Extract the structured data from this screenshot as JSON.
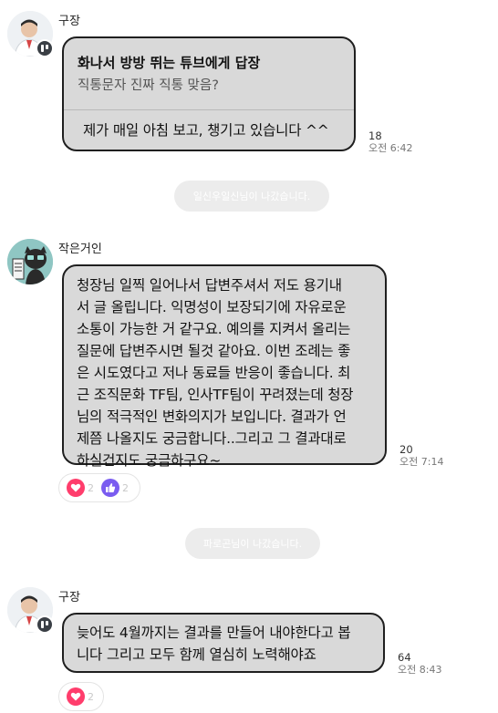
{
  "messages": [
    {
      "sender": "구장",
      "reply_title": "화나서 방방 뛰는 튜브에게 답장",
      "reply_quote": "직통문자 진짜 직통 맞음?",
      "text": "제가 매일 아침 보고, 챙기고 있습니다 ^^",
      "read_count": "18",
      "time": "오전 6:42"
    },
    {
      "system": "일신우일신님이 나갔습니다."
    },
    {
      "sender": "작은거인",
      "lines": [
        "청장님 일찍 일어나서 답변주셔서 저도 용기내",
        "서 글 올립니다. 익명성이 보장되기에 자유로운",
        "소통이 가능한 거 같구요. 예의를 지켜서 올리는",
        "질문에 답변주시면 될것 같아요. 이번 조례는 좋",
        "은 시도였다고 저나 동료들 반응이 좋습니다. 최",
        "근 조직문화 TF팀, 인사TF팀이 꾸려졌는데 청장",
        "님의 적극적인 변화의지가 보입니다. 결과가 언",
        "제쯤 나올지도 궁금합니다..그리고 그 결과대로",
        "하실건지도 궁금하구요~"
      ],
      "read_count": "20",
      "time": "오전 7:14",
      "reactions": [
        {
          "icon": "heart-icon",
          "count": "2",
          "color": "#ff3d6c"
        },
        {
          "icon": "thumbs-up-icon",
          "count": "2",
          "color": "#7a5cf0"
        }
      ]
    },
    {
      "system": "파로곤님이 나갔습니다."
    },
    {
      "sender": "구장",
      "lines": [
        "늦어도 4월까지는 결과를 만들어 내야한다고 봅",
        "니다 그리고 모두 함께 열심히 노력해야죠"
      ],
      "read_count": "64",
      "time": "오전 8:43",
      "reactions": [
        {
          "icon": "heart-icon",
          "count": "2",
          "color": "#ff3d6c"
        }
      ]
    }
  ]
}
